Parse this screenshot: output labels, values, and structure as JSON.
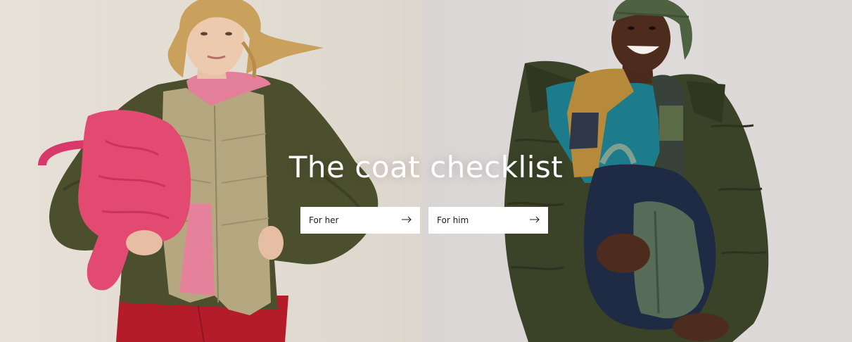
{
  "hero": {
    "headline": "The coat checklist",
    "ctas": [
      {
        "label": "For her",
        "icon": "arrow-right-icon"
      },
      {
        "label": "For him",
        "icon": "arrow-right-icon"
      }
    ]
  },
  "colors": {
    "left_background": "#e3ddd3",
    "right_background": "#dcd8d8",
    "headline_text": "#ffffff",
    "button_background": "#ffffff",
    "button_text": "#1a1a1a"
  }
}
